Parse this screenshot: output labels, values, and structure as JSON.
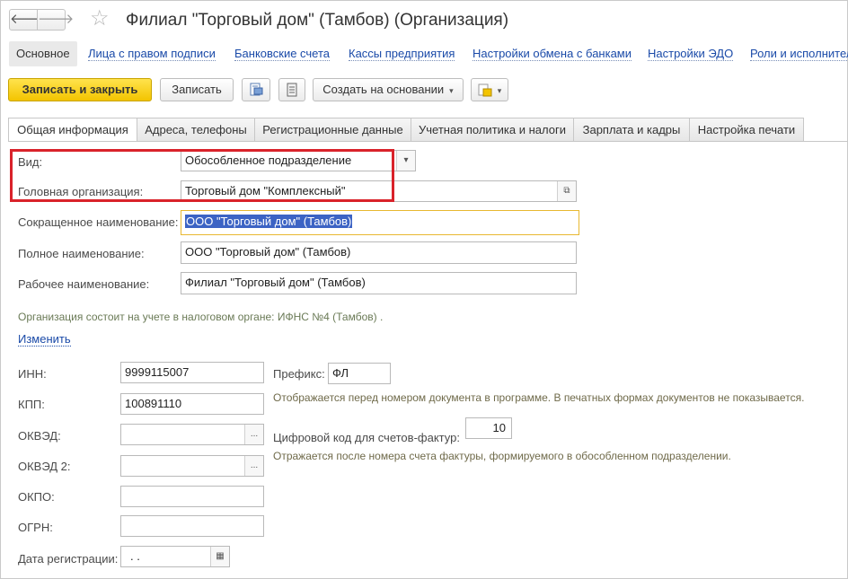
{
  "window": {
    "title": "Филиал \"Торговый дом\" (Тамбов) (Организация)",
    "back_glyph": "🡐",
    "forward_glyph": "🡒",
    "star_glyph": "☆"
  },
  "linkbar": {
    "items": [
      {
        "label": "Основное",
        "active": true
      },
      {
        "label": "Лица с правом подписи"
      },
      {
        "label": "Банковские счета"
      },
      {
        "label": "Кассы предприятия"
      },
      {
        "label": "Настройки обмена с банками"
      },
      {
        "label": "Настройки ЭДО"
      },
      {
        "label": "Роли и исполнители"
      }
    ]
  },
  "toolbar": {
    "save_close_label": "Записать и закрыть",
    "save_label": "Записать",
    "create_based_label": "Создать на основании",
    "dropdown_glyph": "▾"
  },
  "tabs": [
    {
      "label": "Общая информация",
      "active": true
    },
    {
      "label": "Адреса, телефоны"
    },
    {
      "label": "Регистрационные данные"
    },
    {
      "label": "Учетная политика и налоги"
    },
    {
      "label": "Зарплата и кадры"
    },
    {
      "label": "Настройка печати"
    }
  ],
  "form": {
    "vid": {
      "label": "Вид:",
      "value": "Обособленное подразделение"
    },
    "head_org": {
      "label": "Головная организация:",
      "value": "Торговый дом \"Комплексный\""
    },
    "short_name": {
      "label": "Сокращенное наименование:",
      "value": "ООО \"Торговый дом\" (Тамбов)"
    },
    "full_name": {
      "label": "Полное наименование:",
      "value": "ООО \"Торговый дом\" (Тамбов)"
    },
    "work_name": {
      "label": "Рабочее наименование:",
      "value": "Филиал \"Торговый дом\" (Тамбов)"
    },
    "tax_note": "Организация состоит на учете в налоговом органе: ИФНС №4 (Тамбов) .",
    "change_link": "Изменить",
    "inn": {
      "label": "ИНН:",
      "value": "9999115007"
    },
    "kpp": {
      "label": "КПП:",
      "value": "100891110"
    },
    "okved": {
      "label": "ОКВЭД:",
      "value": ""
    },
    "okved2": {
      "label": "ОКВЭД 2:",
      "value": ""
    },
    "okpo": {
      "label": "ОКПО:",
      "value": ""
    },
    "ogrn": {
      "label": "ОГРН:",
      "value": ""
    },
    "reg_date": {
      "label": "Дата регистрации:",
      "value": " .  ."
    },
    "prefix": {
      "label": "Префикс:",
      "value": "ФЛ"
    },
    "prefix_hint": "Отображается перед номером документа в программе. В печатных формах документов не показывается.",
    "invoice_code": {
      "label": "Цифровой код для счетов-фактур:",
      "value": "10"
    },
    "invoice_hint": "Отражается после номера счета фактуры, формируемого в обособленном подразделении.",
    "ellipsis_glyph": "...",
    "calendar_glyph": "▦",
    "open_glyph": "⧉"
  },
  "colors": {
    "accent_link": "#1a4aa8",
    "primary_button": "#f3c400",
    "highlight_box": "#d9222a",
    "focus_border": "#e8b830",
    "selection": "#3c63c4"
  }
}
